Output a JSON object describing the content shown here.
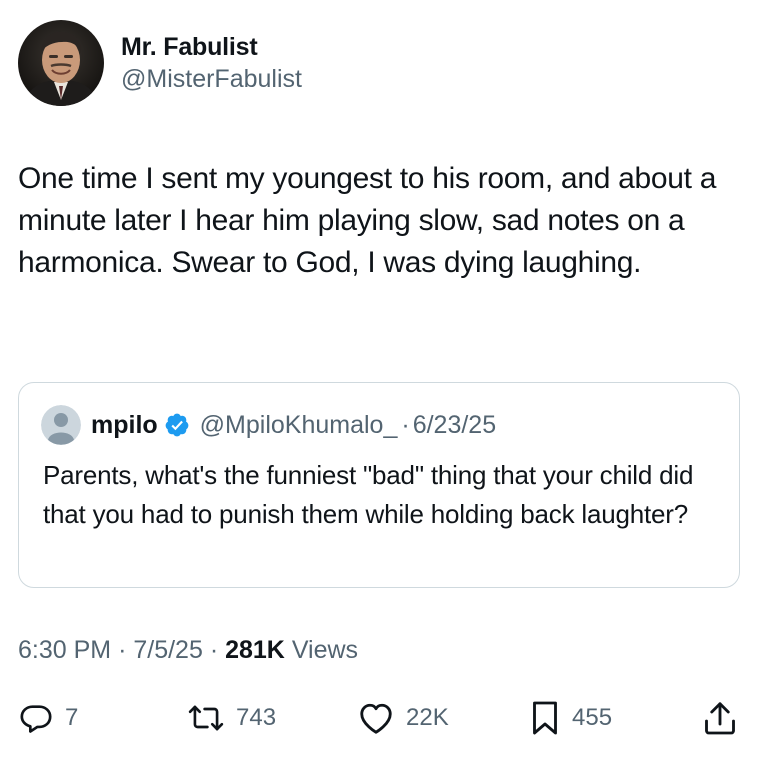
{
  "author": {
    "display_name": "Mr. Fabulist",
    "handle": "@MisterFabulist"
  },
  "tweet": {
    "text": "One time I sent my youngest to his room, and about a minute later I hear him playing slow, sad notes on a harmonica. Swear to God, I was dying laughing."
  },
  "quote": {
    "display_name": "mpilo",
    "handle": "@MpiloKhumalo_",
    "separator": "·",
    "date": "6/23/25",
    "text": "Parents, what's the funniest \"bad\" thing that your child did that you had to punish them while holding back laughter?"
  },
  "meta": {
    "time": "6:30 PM",
    "separator": "·",
    "date": "7/5/25",
    "views_count": "281K",
    "views_label": "Views"
  },
  "actions": {
    "replies": "7",
    "reposts": "743",
    "likes": "22K",
    "bookmarks": "455"
  },
  "icons": {
    "reply": "reply-icon",
    "repost": "repost-icon",
    "like": "heart-icon",
    "bookmark": "bookmark-icon",
    "share": "share-icon",
    "verified": "verified-badge-icon"
  },
  "colors": {
    "text": "#0f1419",
    "secondary": "#536471",
    "verified": "#1d9bf0",
    "border": "#cfd9de"
  }
}
